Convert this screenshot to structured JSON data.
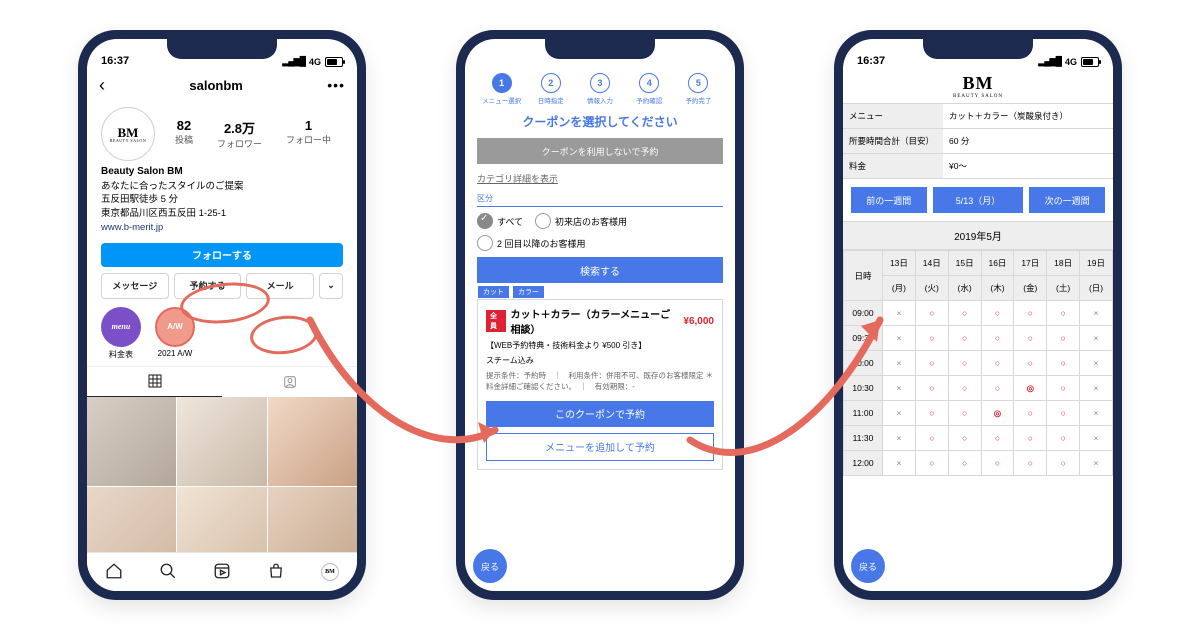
{
  "statusbar": {
    "time": "16:37",
    "net": "4G",
    "bars": "▂▄▆█"
  },
  "phone1": {
    "username": "salonbm",
    "stats": [
      {
        "num": "82",
        "label": "投稿"
      },
      {
        "num": "2.8万",
        "label": "フォロワー"
      },
      {
        "num": "1",
        "label": "フォロー中"
      }
    ],
    "avatar_text": "BM",
    "avatar_sub": "BEAUTY SALON",
    "bio_name": "Beauty Salon BM",
    "bio_lines": [
      "あなたに合ったスタイルのご提案",
      "五反田駅徒歩 5 分",
      "東京都品川区西五反田 1-25-1"
    ],
    "bio_link": "www.b-merit.jp",
    "follow_btn": "フォローする",
    "actions": {
      "msg": "メッセージ",
      "reserve": "予約する",
      "mail": "メール"
    },
    "highlights": [
      {
        "label": "料金表",
        "ring_text": "menu"
      },
      {
        "label": "2021 A/W",
        "ring_text": "A/W"
      }
    ]
  },
  "phone2": {
    "steps": [
      {
        "n": "1",
        "label": "メニュー選択"
      },
      {
        "n": "2",
        "label": "日時指定"
      },
      {
        "n": "3",
        "label": "情報入力"
      },
      {
        "n": "4",
        "label": "予約確認"
      },
      {
        "n": "5",
        "label": "予約完了"
      }
    ],
    "title": "クーポンを選択してください",
    "no_coupon_btn": "クーポンを利用しないで予約",
    "detail_link": "カテゴリ詳細を表示",
    "section": "区分",
    "radios": {
      "all": "すべて",
      "first": "初来店のお客様用",
      "repeat": "2 回目以降のお客様用"
    },
    "search_btn": "検索する",
    "tags": [
      "カット",
      "カラー"
    ],
    "coupon": {
      "badge": "全員",
      "name": "カット＋カラー（カラーメニューご相談）",
      "price": "¥6,000",
      "sub1": "【WEB予約特典・技術料金より ¥500 引き】",
      "sub2": "スチーム込み",
      "note": "提示条件：予約時　｜　利用条件：併用不可、既存のお客様限定\n＊料金詳細ご確認ください。　｜　有効期限：-",
      "btn_use": "このクーポンで予約",
      "btn_add": "メニューを追加して予約"
    },
    "fab": "戻る"
  },
  "phone3": {
    "logo": "BM",
    "logo_sub": "BEAUTY SALON",
    "info": [
      {
        "k": "メニュー",
        "v": "カット＋カラー（炭酸泉付き）"
      },
      {
        "k": "所要時間合計（目安）",
        "v": "60 分"
      },
      {
        "k": "料金",
        "v": "¥0～"
      }
    ],
    "nav": {
      "prev": "前の一週間",
      "cur": "5/13（月）",
      "next": "次の一週間"
    },
    "month": "2019年5月",
    "time_header": "日時",
    "days": [
      {
        "d": "13日",
        "w": "(月)"
      },
      {
        "d": "14日",
        "w": "(火)"
      },
      {
        "d": "15日",
        "w": "(水)"
      },
      {
        "d": "16日",
        "w": "(木)"
      },
      {
        "d": "17日",
        "w": "(金)"
      },
      {
        "d": "18日",
        "w": "(土)"
      },
      {
        "d": "19日",
        "w": "(日)"
      }
    ],
    "rows": [
      {
        "t": "09:00",
        "c": [
          "x",
          "o",
          "o",
          "o",
          "o",
          "o",
          "x"
        ]
      },
      {
        "t": "09:30",
        "c": [
          "x",
          "o",
          "o",
          "o",
          "o",
          "o",
          "x"
        ]
      },
      {
        "t": "10:00",
        "c": [
          "x",
          "o",
          "o",
          "o",
          "o",
          "o",
          "x"
        ]
      },
      {
        "t": "10:30",
        "c": [
          "x",
          "o",
          "o",
          "o",
          "d",
          "o",
          "x"
        ]
      },
      {
        "t": "11:00",
        "c": [
          "x",
          "o",
          "o",
          "d",
          "o",
          "o",
          "x"
        ]
      },
      {
        "t": "11:30",
        "c": [
          "x",
          "o",
          "o",
          "o",
          "o",
          "o",
          "x"
        ]
      },
      {
        "t": "12:00",
        "c": [
          "x",
          "o",
          "o",
          "o",
          "o",
          "o",
          "x"
        ]
      }
    ],
    "fab": "戻る"
  }
}
